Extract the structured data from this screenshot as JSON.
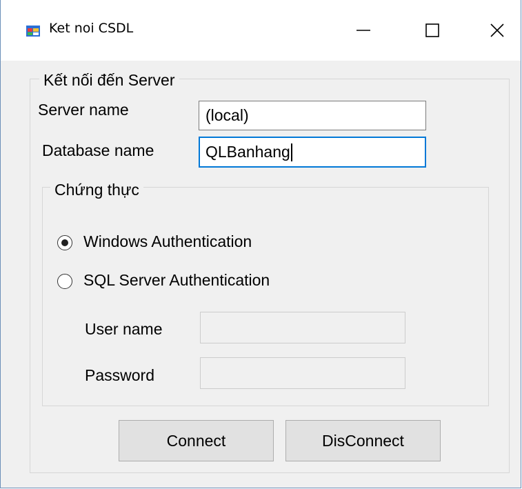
{
  "window": {
    "title": "Ket noi CSDL",
    "icon": "winforms-app-icon",
    "border_color": "#6b8fb8"
  },
  "connection_group": {
    "legend": "Kết nối đến Server",
    "server_name_label": "Server name",
    "server_name_value": "(local)",
    "database_name_label": "Database name",
    "database_name_value": "QLBanhang"
  },
  "auth_group": {
    "legend": "Chứng thực",
    "windows_auth_label": "Windows Authentication",
    "windows_auth_checked": true,
    "sql_auth_label": "SQL Server Authentication",
    "sql_auth_checked": false,
    "username_label": "User name",
    "username_value": "",
    "password_label": "Password",
    "password_value": ""
  },
  "buttons": {
    "connect_label": "Connect",
    "disconnect_label": "DisConnect"
  },
  "colors": {
    "focus_border": "#0078d7",
    "button_face": "#e1e1e1",
    "form_background": "#f0f0f0"
  }
}
